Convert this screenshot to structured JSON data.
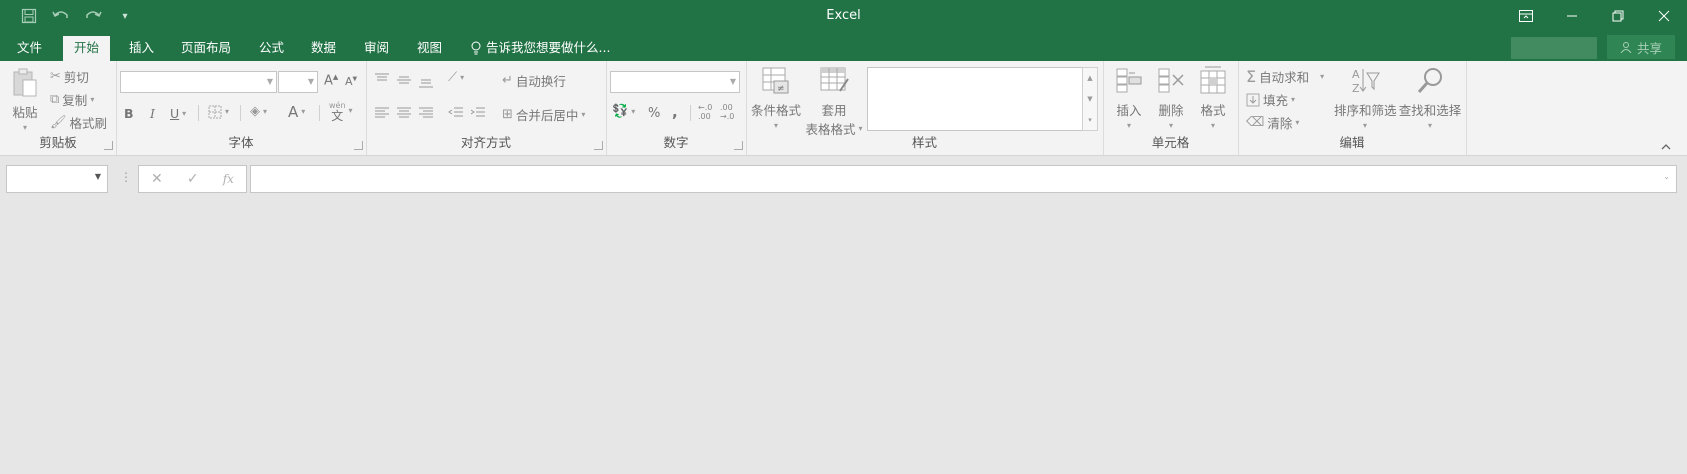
{
  "app": {
    "title": "Excel"
  },
  "window_controls": {
    "ribbon_display_icon": "ribbon-display-icon",
    "minimize_icon": "minimize-icon",
    "restore_icon": "restore-icon",
    "close_icon": "close-icon"
  },
  "tabs": [
    "文件",
    "开始",
    "插入",
    "页面布局",
    "公式",
    "数据",
    "审阅",
    "视图"
  ],
  "tell_me": "告诉我您想要做什么...",
  "share": "共享",
  "clipboard": {
    "group": "剪贴板",
    "paste": "粘贴",
    "cut": "剪切",
    "copy": "复制",
    "format_painter": "格式刷"
  },
  "font": {
    "group": "字体",
    "bold": "B",
    "italic": "I",
    "underline": "U",
    "grow": "A",
    "shrink": "A",
    "color": "A",
    "wen": "文"
  },
  "alignment": {
    "group": "对齐方式",
    "wrap": "自动换行",
    "merge": "合并后居中"
  },
  "number": {
    "group": "数字",
    "percent": "%",
    "comma": ",",
    "inc_decimal": ".00",
    "dec_decimal": ".00"
  },
  "styles": {
    "group": "样式",
    "conditional": "条件格式",
    "table_line1": "套用",
    "table_line2": "表格格式"
  },
  "cells": {
    "group": "单元格",
    "insert": "插入",
    "delete": "删除",
    "format": "格式"
  },
  "editing": {
    "group": "编辑",
    "autosum": "自动求和",
    "fill": "填充",
    "clear": "清除",
    "sort": "排序和筛选",
    "find": "查找和选择"
  },
  "formula_bar": {
    "fx": "fx"
  },
  "colors": {
    "brand": "#217346",
    "ribbon": "#f3f3f3",
    "canvas": "#e6e6e6"
  }
}
